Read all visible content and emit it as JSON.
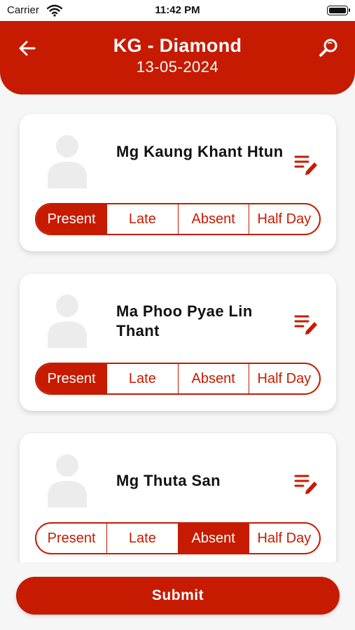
{
  "status_bar": {
    "carrier": "Carrier",
    "time": "11:42 PM"
  },
  "header": {
    "title": "KG - Diamond",
    "date": "13-05-2024"
  },
  "icons": {
    "back": "back-arrow-icon",
    "search": "search-icon",
    "note": "edit-note-icon",
    "avatar": "person-placeholder-icon"
  },
  "attendance_options": [
    "Present",
    "Late",
    "Absent",
    "Half Day"
  ],
  "students": [
    {
      "name": "Mg Kaung Khant Htun",
      "status": "Present"
    },
    {
      "name": "Ma Phoo Pyae Lin Thant",
      "status": "Present"
    },
    {
      "name": "Mg Thuta San",
      "status": "Absent"
    }
  ],
  "submit_label": "Submit",
  "colors": {
    "accent": "#c61b00",
    "background": "#f6f6f6",
    "avatar": "#ececec"
  }
}
